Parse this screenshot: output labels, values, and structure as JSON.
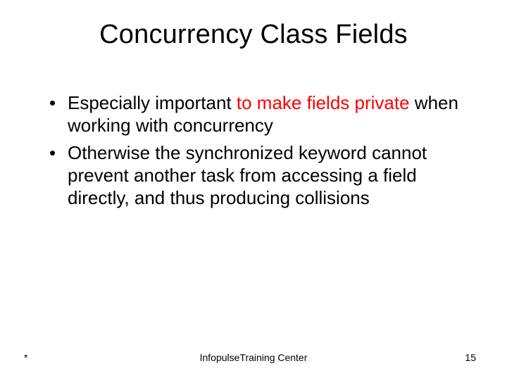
{
  "title": "Concurrency Class Fields",
  "bullets": [
    {
      "pre": "Especially important ",
      "em": "to make fields private",
      "post": " when working with concurrency"
    },
    {
      "pre": "Otherwise the synchronized keyword cannot prevent another task from accessing a field directly, and thus producing collisions",
      "em": "",
      "post": ""
    }
  ],
  "footer": {
    "left": "*",
    "center": "InfopulseTraining Center",
    "right": "15"
  }
}
